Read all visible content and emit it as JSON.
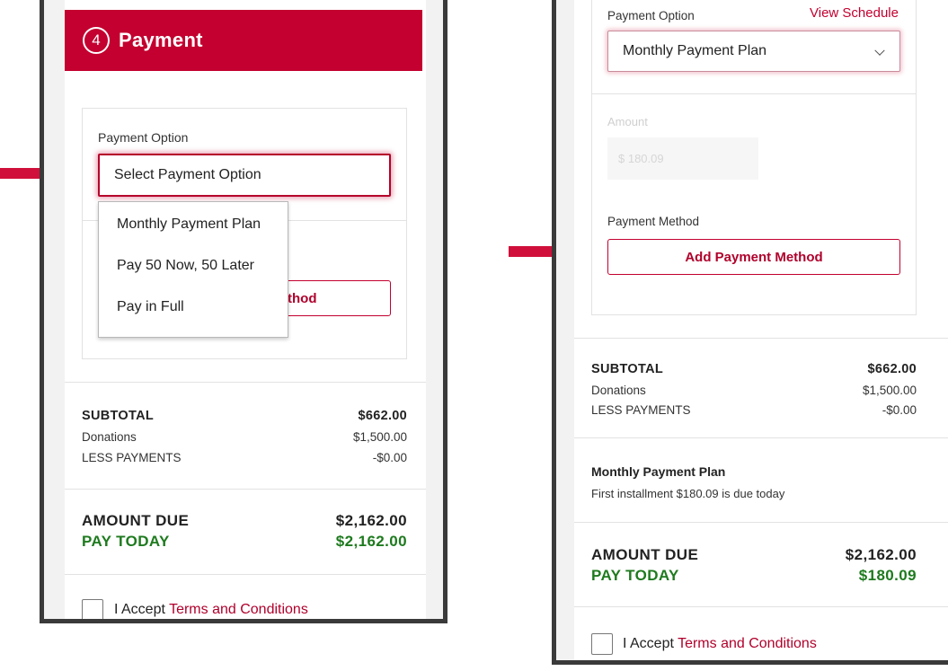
{
  "left": {
    "header": {
      "step": "4",
      "title": "Payment"
    },
    "payment_option_label": "Payment Option",
    "select_placeholder": "Select Payment Option",
    "options": [
      "Monthly Payment Plan",
      "Pay 50 Now, 50 Later",
      "Pay in Full"
    ],
    "hidden_button_fragment": "thod",
    "summary": {
      "subtotal_label": "SUBTOTAL",
      "subtotal_value": "$662.00",
      "donations_label": "Donations",
      "donations_value": "$1,500.00",
      "less_label": "LESS PAYMENTS",
      "less_value": "-$0.00"
    },
    "due": {
      "amount_label": "AMOUNT DUE",
      "amount_value": "$2,162.00",
      "today_label": "PAY TODAY",
      "today_value": "$2,162.00"
    },
    "accept": {
      "prefix": "I Accept ",
      "link": "Terms and Conditions"
    }
  },
  "right": {
    "payment_option_label": "Payment Option",
    "view_schedule": "View Schedule",
    "select_value": "Monthly Payment Plan",
    "amount_label": "Amount",
    "amount_value": "$ 180.09",
    "payment_method_label": "Payment Method",
    "add_method_button": "Add Payment Method",
    "summary": {
      "subtotal_label": "SUBTOTAL",
      "subtotal_value": "$662.00",
      "donations_label": "Donations",
      "donations_value": "$1,500.00",
      "less_label": "LESS PAYMENTS",
      "less_value": "-$0.00"
    },
    "plan": {
      "title": "Monthly Payment Plan",
      "subtitle": "First installment $180.09 is due today"
    },
    "due": {
      "amount_label": "AMOUNT DUE",
      "amount_value": "$2,162.00",
      "today_label": "PAY TODAY",
      "today_value": "$180.09"
    },
    "accept": {
      "prefix": "I Accept ",
      "link": "Terms and Conditions"
    }
  },
  "colors": {
    "brand": "#c3002f",
    "green": "#1e7a1e",
    "arrow": "#d0103a"
  },
  "icons": [
    "arrow-right-icon",
    "chevron-down-icon",
    "checkbox-icon"
  ]
}
